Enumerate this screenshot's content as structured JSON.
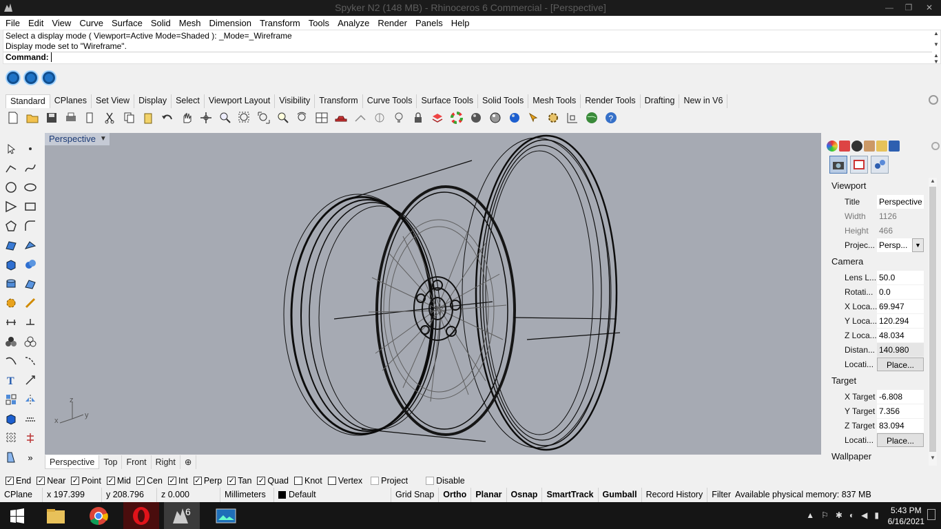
{
  "window": {
    "title": "Spyker N2 (148 MB) - Rhinoceros 6 Commercial - [Perspective]",
    "min": "—",
    "max": "❐",
    "close": "✕"
  },
  "menu": [
    "File",
    "Edit",
    "View",
    "Curve",
    "Surface",
    "Solid",
    "Mesh",
    "Dimension",
    "Transform",
    "Tools",
    "Analyze",
    "Render",
    "Panels",
    "Help"
  ],
  "command": {
    "history1": "Select a display mode ( Viewport=Active  Mode=Shaded ): _Mode=_Wireframe",
    "history2": "Display mode set to \"Wireframe\".",
    "prompt": "Command:"
  },
  "toolbar_tabs": [
    "Standard",
    "CPlanes",
    "Set View",
    "Display",
    "Select",
    "Viewport Layout",
    "Visibility",
    "Transform",
    "Curve Tools",
    "Surface Tools",
    "Solid Tools",
    "Mesh Tools",
    "Render Tools",
    "Drafting",
    "New in V6"
  ],
  "viewport": {
    "title": "Perspective",
    "axis_x": "x",
    "axis_y": "y",
    "axis_z": "z"
  },
  "viewport_tabs": [
    "Perspective",
    "Top",
    "Front",
    "Right",
    "⊕"
  ],
  "panel": {
    "section_viewport": "Viewport",
    "title_k": "Title",
    "title_v": "Perspective",
    "width_k": "Width",
    "width_v": "1126",
    "height_k": "Height",
    "height_v": "466",
    "proj_k": "Projec...",
    "proj_v": "Persp...",
    "section_camera": "Camera",
    "lens_k": "Lens L...",
    "lens_v": "50.0",
    "rot_k": "Rotati...",
    "rot_v": "0.0",
    "xloc_k": "X Loca...",
    "xloc_v": "69.947",
    "yloc_k": "Y Loca...",
    "yloc_v": "120.294",
    "zloc_k": "Z Loca...",
    "zloc_v": "48.034",
    "dist_k": "Distan...",
    "dist_v": "140.980",
    "loc1_k": "Locati...",
    "loc1_v": "Place...",
    "section_target": "Target",
    "xt_k": "X Target",
    "xt_v": "-6.808",
    "yt_k": "Y Target",
    "yt_v": "7.356",
    "zt_k": "Z Target",
    "zt_v": "83.094",
    "loc2_k": "Locati...",
    "loc2_v": "Place...",
    "section_wallpaper": "Wallpaper"
  },
  "osnaps": [
    {
      "label": "End",
      "checked": true
    },
    {
      "label": "Near",
      "checked": true
    },
    {
      "label": "Point",
      "checked": true
    },
    {
      "label": "Mid",
      "checked": true
    },
    {
      "label": "Cen",
      "checked": true
    },
    {
      "label": "Int",
      "checked": true
    },
    {
      "label": "Perp",
      "checked": true
    },
    {
      "label": "Tan",
      "checked": true
    },
    {
      "label": "Quad",
      "checked": true
    },
    {
      "label": "Knot",
      "checked": false
    },
    {
      "label": "Vertex",
      "checked": false
    },
    {
      "label": "Project",
      "checked": false
    },
    {
      "label": "Disable",
      "checked": false
    }
  ],
  "status": {
    "cplane": "CPlane",
    "x": "x 197.399",
    "y": "y 208.796",
    "z": "z 0.000",
    "units": "Millimeters",
    "layer": "Default",
    "gridsnap": "Grid Snap",
    "ortho": "Ortho",
    "planar": "Planar",
    "osnap": "Osnap",
    "smarttrack": "SmartTrack",
    "gumball": "Gumball",
    "history": "Record History",
    "filter": "Filter",
    "memory": "Available physical memory: 837 MB"
  },
  "taskbar": {
    "time": "5:43 PM",
    "date": "6/16/2021",
    "rhino_badge": "6"
  },
  "colors": {
    "viewport_bg": "#a6aab3",
    "title_bar": "#1b1b1b",
    "taskbar": "#151515"
  }
}
